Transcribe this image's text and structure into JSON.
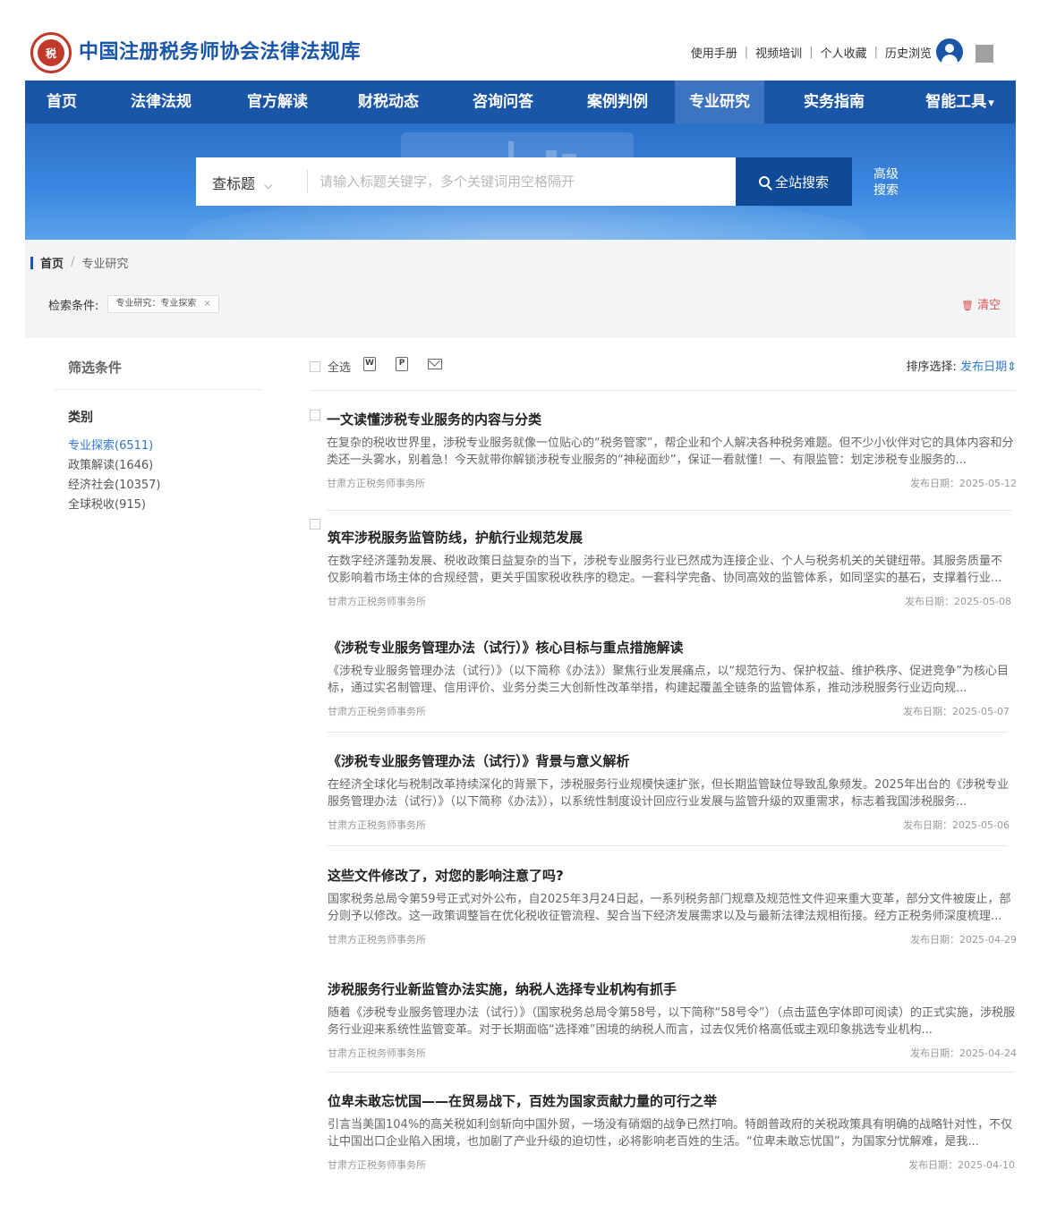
{
  "header": {
    "emblem_text": "税",
    "site_title": "中国注册税务师协会法律法规库",
    "links": [
      "使用手册",
      "视频培训",
      "个人收藏",
      "历史浏览"
    ]
  },
  "nav": {
    "items": [
      "首页",
      "法律法规",
      "官方解读",
      "财税动态",
      "咨询问答",
      "案例判例",
      "专业研究",
      "实务指南",
      "智能工具"
    ],
    "active": "专业研究",
    "dropdown_marker": "▾"
  },
  "search": {
    "scope": "查标题",
    "scope_chevron": "⌵",
    "placeholder": "请输入标题关键字，多个关键词用空格隔开",
    "button_label": "全站搜索",
    "advanced_label": "高级搜索"
  },
  "breadcrumb": {
    "home": "首页",
    "current": "专业研究"
  },
  "conditions": {
    "label": "检索条件:",
    "tag": "专业研究：专业探索",
    "tag_close": "×",
    "clear_label": "清空",
    "clear_icon": "🗑"
  },
  "sidebar": {
    "title": "筛选条件",
    "category_label": "类别",
    "items": [
      "专业探索(6511)",
      "政策解读(1646)",
      "经济社会(10357)",
      "全球税收(915)"
    ],
    "active_index": 0
  },
  "toolbar": {
    "select_all": "全选",
    "word_icon": "W",
    "pdf_icon": "P",
    "sort_label": "排序选择:",
    "sort_value": "发布日期",
    "sort_arrow": "⇕"
  },
  "articles": [
    {
      "title": "一文读懂涉税专业服务的内容与分类",
      "summary": "在复杂的税收世界里，涉税专业服务就像一位贴心的“税务管家”，帮企业和个人解决各种税务难题。但不少小伙伴对它的具体内容和分类还一头雾水，别着急！今天就带你解锁涉税专业服务的“神秘面纱”，保证一看就懂！一、有限监管：划定涉税专业服务的...",
      "source": "甘肃方正税务师事务所",
      "date": "发布日期：2025-05-12"
    },
    {
      "title": "筑牢涉税服务监管防线，护航行业规范发展",
      "summary": "在数字经济蓬勃发展、税收政策日益复杂的当下，涉税专业服务行业已然成为连接企业、个人与税务机关的关键纽带。其服务质量不仅影响着市场主体的合规经营，更关乎国家税收秩序的稳定。一套科学完备、协同高效的监管体系，如同坚实的基石，支撑着行业...",
      "source": "甘肃方正税务师事务所",
      "date": "发布日期：2025-05-08"
    },
    {
      "title": "《涉税专业服务管理办法（试行）》核心目标与重点措施解读",
      "summary": "《涉税专业服务管理办法（试行）》（以下简称《办法》）聚焦行业发展痛点，以“规范行为、保护权益、维护秩序、促进竞争”为核心目标，通过实名制管理、信用评价、业务分类三大创新性改革举措，构建起覆盖全链条的监管体系，推动涉税服务行业迈向规...",
      "source": "甘肃方正税务师事务所",
      "date": "发布日期：2025-05-07"
    },
    {
      "title": "《涉税专业服务管理办法（试行）》背景与意义解析",
      "summary": "在经济全球化与税制改革持续深化的背景下，涉税服务行业规模快速扩张，但长期监管缺位导致乱象频发。2025年出台的《涉税专业服务管理办法（试行）》（以下简称《办法》），以系统性制度设计回应行业发展与监管升级的双重需求，标志着我国涉税服务...",
      "source": "甘肃方正税务师事务所",
      "date": "发布日期：2025-05-06"
    },
    {
      "title": "这些文件修改了，对您的影响注意了吗?",
      "summary": "国家税务总局令第59号正式对外公布，自2025年3月24日起，一系列税务部门规章及规范性文件迎来重大变革，部分文件被废止，部分则予以修改。这一政策调整旨在优化税收征管流程、契合当下经济发展需求以及与最新法律法规相衔接。经方正税务师深度梳理...",
      "source": "甘肃方正税务师事务所",
      "date": "发布日期：2025-04-29"
    },
    {
      "title": "涉税服务行业新监管办法实施，纳税人选择专业机构有抓手",
      "summary": "随着《涉税专业服务管理办法（试行）》（国家税务总局令第58号，以下简称“58号令”）（点击蓝色字体即可阅读）的正式实施，涉税服务行业迎来系统性监管变革。对于长期面临“选择难”困境的纳税人而言，过去仅凭价格高低或主观印象挑选专业机构...",
      "source": "甘肃方正税务师事务所",
      "date": "发布日期：2025-04-24"
    },
    {
      "title": "位卑未敢忘忧国——在贸易战下，百姓为国家贡献力量的可行之举",
      "summary": "引言当美国104%的高关税如利剑斩向中国外贸，一场没有硝烟的战争已然打响。特朗普政府的关税政策具有明确的战略针对性，不仅让中国出口企业陷入困境，也加剧了产业升级的迫切性，必将影响老百姓的生活。“位卑未敢忘忧国”，为国家分忧解难，是我...",
      "source": "甘肃方正税务师事务所",
      "date": "发布日期：2025-04-10"
    }
  ]
}
